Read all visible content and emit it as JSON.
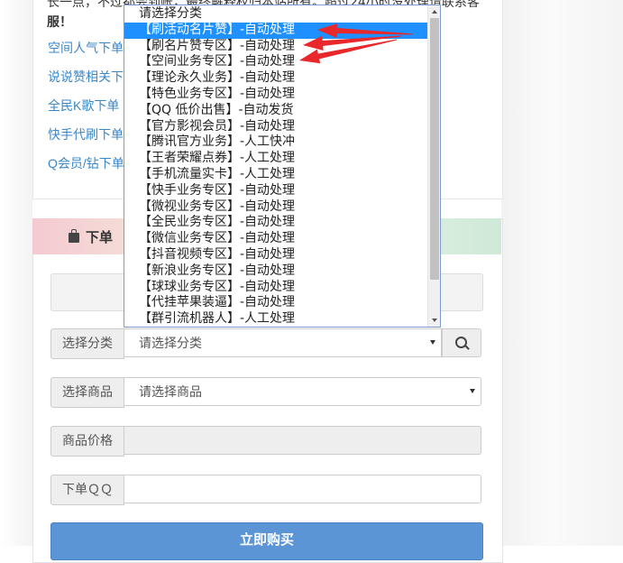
{
  "notice": {
    "line1_prefix": "长一点，不过都会到账，最终解释权归本站所有。超过24小时没处理请联系客",
    "line2": "服！"
  },
  "links": [
    "空间人气下单",
    "说说赞相关下",
    "全民K歌下单",
    "快手代刷下单",
    "Q会员/钻下单"
  ],
  "order_panel": {
    "title": "下单"
  },
  "form": {
    "category_label": "选择分类",
    "category_value": "请选择分类",
    "product_label": "选择商品",
    "product_value": "请选择商品",
    "price_label": "商品价格",
    "price_value": "",
    "qq_label": "下单ＱＱ",
    "qq_value": "",
    "buy_label": "立即购买"
  },
  "dropdown": {
    "selected_index": 1,
    "options": [
      "请选择分类",
      "【刷活动名片赞】-自动处理",
      "【刷名片赞专区】-自动处理",
      "【空间业务专区】-自动处理",
      "【理论永久业务】-自动处理",
      "【特色业务专区】-自动处理",
      "【QQ 低价出售】-自动发货",
      "【官方影视会员】-自动处理",
      "【腾讯官方业务】-人工快冲",
      "【王者荣耀点券】-人工处理",
      "【手机流量实卡】-人工处理",
      "【快手业务专区】-自动处理",
      "【微视业务专区】-自动处理",
      "【全民业务专区】-自动处理",
      "【微信业务专区】-自动处理",
      "【抖音视频专区】-自动处理",
      "【新浪业务专区】-自动处理",
      "【球球业务专区】-自动处理",
      "【代挂苹果装逼】-自动处理",
      "【群引流机器人】-人工处理"
    ]
  },
  "colors": {
    "selected_bg": "#1e90ff",
    "link": "#3a87c8",
    "buy_button": "#5b95d6",
    "annotation_arrow": "#e8282b"
  }
}
